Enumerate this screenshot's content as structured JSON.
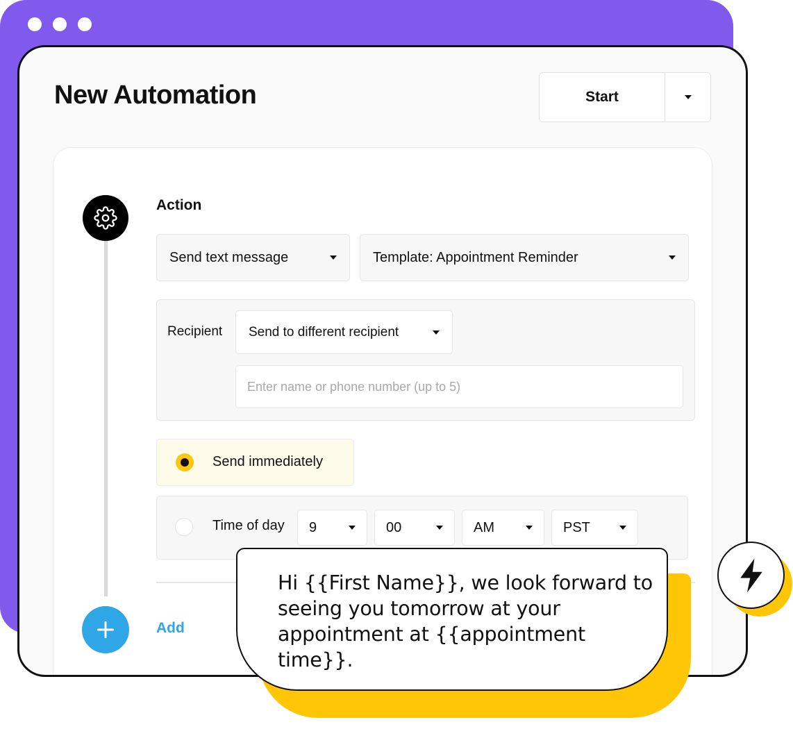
{
  "header": {
    "title": "New Automation",
    "start_label": "Start"
  },
  "step": {
    "action_label": "Action"
  },
  "action_type": {
    "selected": "Send text message"
  },
  "template": {
    "selected": "Template: Appointment Reminder"
  },
  "recipient": {
    "label": "Recipient",
    "selected": "Send to different recipient",
    "placeholder": "Enter name or phone number (up to 5)"
  },
  "timing": {
    "immediate_label": "Send immediately",
    "immediate_selected": true,
    "time_of_day_label": "Time of day",
    "hour": "9",
    "minute": "00",
    "ampm": "AM",
    "timezone": "PST"
  },
  "add_label": "Add",
  "message_preview": "Hi {{First Name}}, we look forward to seeing you tomorrow at your appointment at {{appointment time}}.",
  "icons": [
    "gear-icon",
    "plus-icon",
    "lightning-bolt-icon",
    "chevron-down-icon"
  ],
  "colors": {
    "purple": "#7F5AEC",
    "yellow": "#FFC607",
    "blue": "#2FA6E6",
    "black": "#111111"
  }
}
